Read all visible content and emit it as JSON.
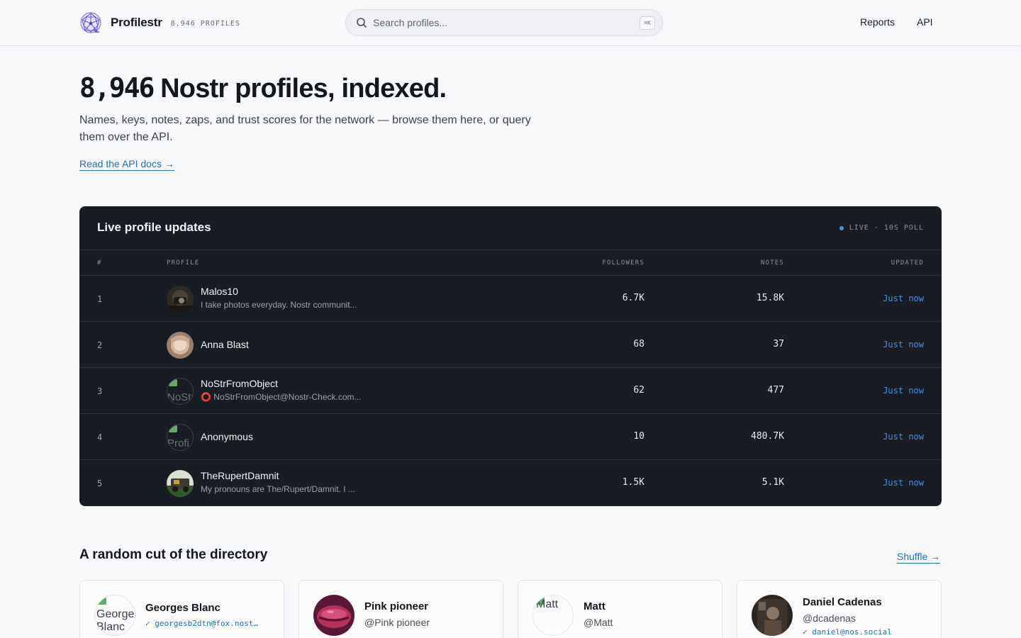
{
  "header": {
    "brand_name": "Profilestr",
    "brand_count": "8,946 PROFILES",
    "search_placeholder": "Search profiles...",
    "search_shortcut": "⌘K",
    "nav": [
      "Reports",
      "API"
    ]
  },
  "hero": {
    "title_number": "8,946",
    "title_rest": " Nostr profiles, indexed.",
    "subtitle": "Names, keys, notes, zaps, and trust scores for the network — browse them here, or query them over the API.",
    "link": "Read the API docs →"
  },
  "live_panel": {
    "title": "Live profile updates",
    "status": "LIVE · 10S POLL",
    "columns": [
      "#",
      "PROFILE",
      "FOLLOWERS",
      "NOTES",
      "UPDATED"
    ],
    "rows": [
      {
        "idx": "1",
        "name": "Malos10",
        "bio": "I take photos everyday. Nostr communit...",
        "followers": "6.7K",
        "notes": "15.8K",
        "updated": "Just now"
      },
      {
        "idx": "2",
        "name": "Anna Blast",
        "bio": "",
        "followers": "68",
        "notes": "37",
        "updated": "Just now"
      },
      {
        "idx": "3",
        "name": "NoStrFromObject",
        "bio": "⭕ NoStrFromObject@Nostr-Check.com...",
        "followers": "62",
        "notes": "477",
        "updated": "Just now"
      },
      {
        "idx": "4",
        "name": "Anonymous",
        "bio": "",
        "followers": "10",
        "notes": "480.7K",
        "updated": "Just now"
      },
      {
        "idx": "5",
        "name": "TheRupertDamnit",
        "bio": "My pronouns are The/Rupert/Damnit. I ...",
        "followers": "1.5K",
        "notes": "5.1K",
        "updated": "Just now"
      }
    ],
    "avatar_alt": [
      "",
      "",
      "NoStr",
      "Profi",
      ""
    ]
  },
  "directory": {
    "title": "A random cut of the directory",
    "shuffle": "Shuffle →",
    "cards": [
      {
        "name": "Georges Blanc",
        "handle": "",
        "nip05": "✓ georgesb2dtn@fox.nost…",
        "avatar_alt": "George Blanc"
      },
      {
        "name": "Pink pioneer",
        "handle": "@Pink pioneer",
        "nip05": "",
        "avatar_alt": ""
      },
      {
        "name": "Matt",
        "handle": "@Matt",
        "nip05": "",
        "avatar_alt": "Matt"
      },
      {
        "name": "Daniel Cadenas",
        "handle": "@dcadenas",
        "nip05": "✓ daniel@nos.social",
        "avatar_alt": ""
      }
    ]
  },
  "colors": {
    "accent": "#1d6fbe",
    "live_dot": "#4a8fe7",
    "panel_bg": "#181c23",
    "page_bg": "#f7f8fa"
  }
}
